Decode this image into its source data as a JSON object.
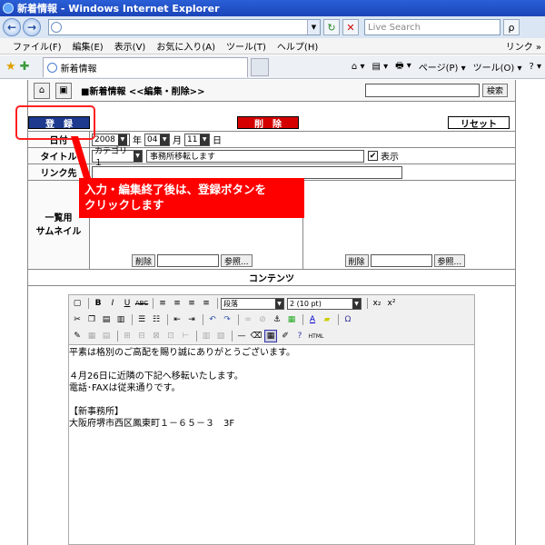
{
  "window": {
    "title": "新着情報 - Windows Internet Explorer",
    "back": "←",
    "forward": "→",
    "address_dropdown": "▼",
    "refresh": "↻",
    "stop": "✕",
    "search_placeholder": "Live Search",
    "search_go": "ρ"
  },
  "menu": {
    "items": [
      "ファイル(F)",
      "編集(E)",
      "表示(V)",
      "お気に入り(A)",
      "ツール(T)",
      "ヘルプ(H)"
    ],
    "links": "リンク »"
  },
  "favbar": {
    "tab_title": "新着情報",
    "commands": [
      "⌂ ▾",
      "▤ ▾",
      "🖶 ▾",
      "ページ(P) ▾",
      "ツール(O) ▾",
      "? ▾"
    ]
  },
  "page": {
    "header_title": "■新着情報 <<編集・削除>>",
    "header_search_button": "検索",
    "register_button": "登　録",
    "delete_button": "削　除",
    "reset_button": "リセット",
    "labels": {
      "date": "日付",
      "title": "タイトル",
      "link": "リンク先",
      "thumbnail": "一覧用\nサムネイル",
      "contents": "コンテンツ"
    },
    "date": {
      "year": "2008",
      "year_unit": "年",
      "month": "04",
      "month_unit": "月",
      "day": "11",
      "day_unit": "日"
    },
    "category": "カテゴリ１",
    "title_value": "事務所移転します",
    "display_checkbox": "✔",
    "display_label": "表示",
    "thumb_delete": "削除",
    "thumb_browse": "参照..."
  },
  "editor": {
    "format_dropdown": "段落",
    "size_dropdown": "2 (10 pt)",
    "html_label": "HTML",
    "body_lines": [
      "平素は格別のご高配を賜り誠にありがとうございます。",
      "",
      "４月26日に近隣の下記へ移転いたします。",
      "電話･FAXは従来通りです。",
      "",
      "【新事務所】",
      "大阪府堺市西区鳳東町１－６５－３　3F"
    ]
  },
  "callout": {
    "line1": "入力・編集終了後は、登録ボタンを",
    "line2": "クリックします"
  },
  "colors": {
    "register": "#1d3a8f",
    "delete": "#d40000",
    "callout": "#ff0000"
  }
}
